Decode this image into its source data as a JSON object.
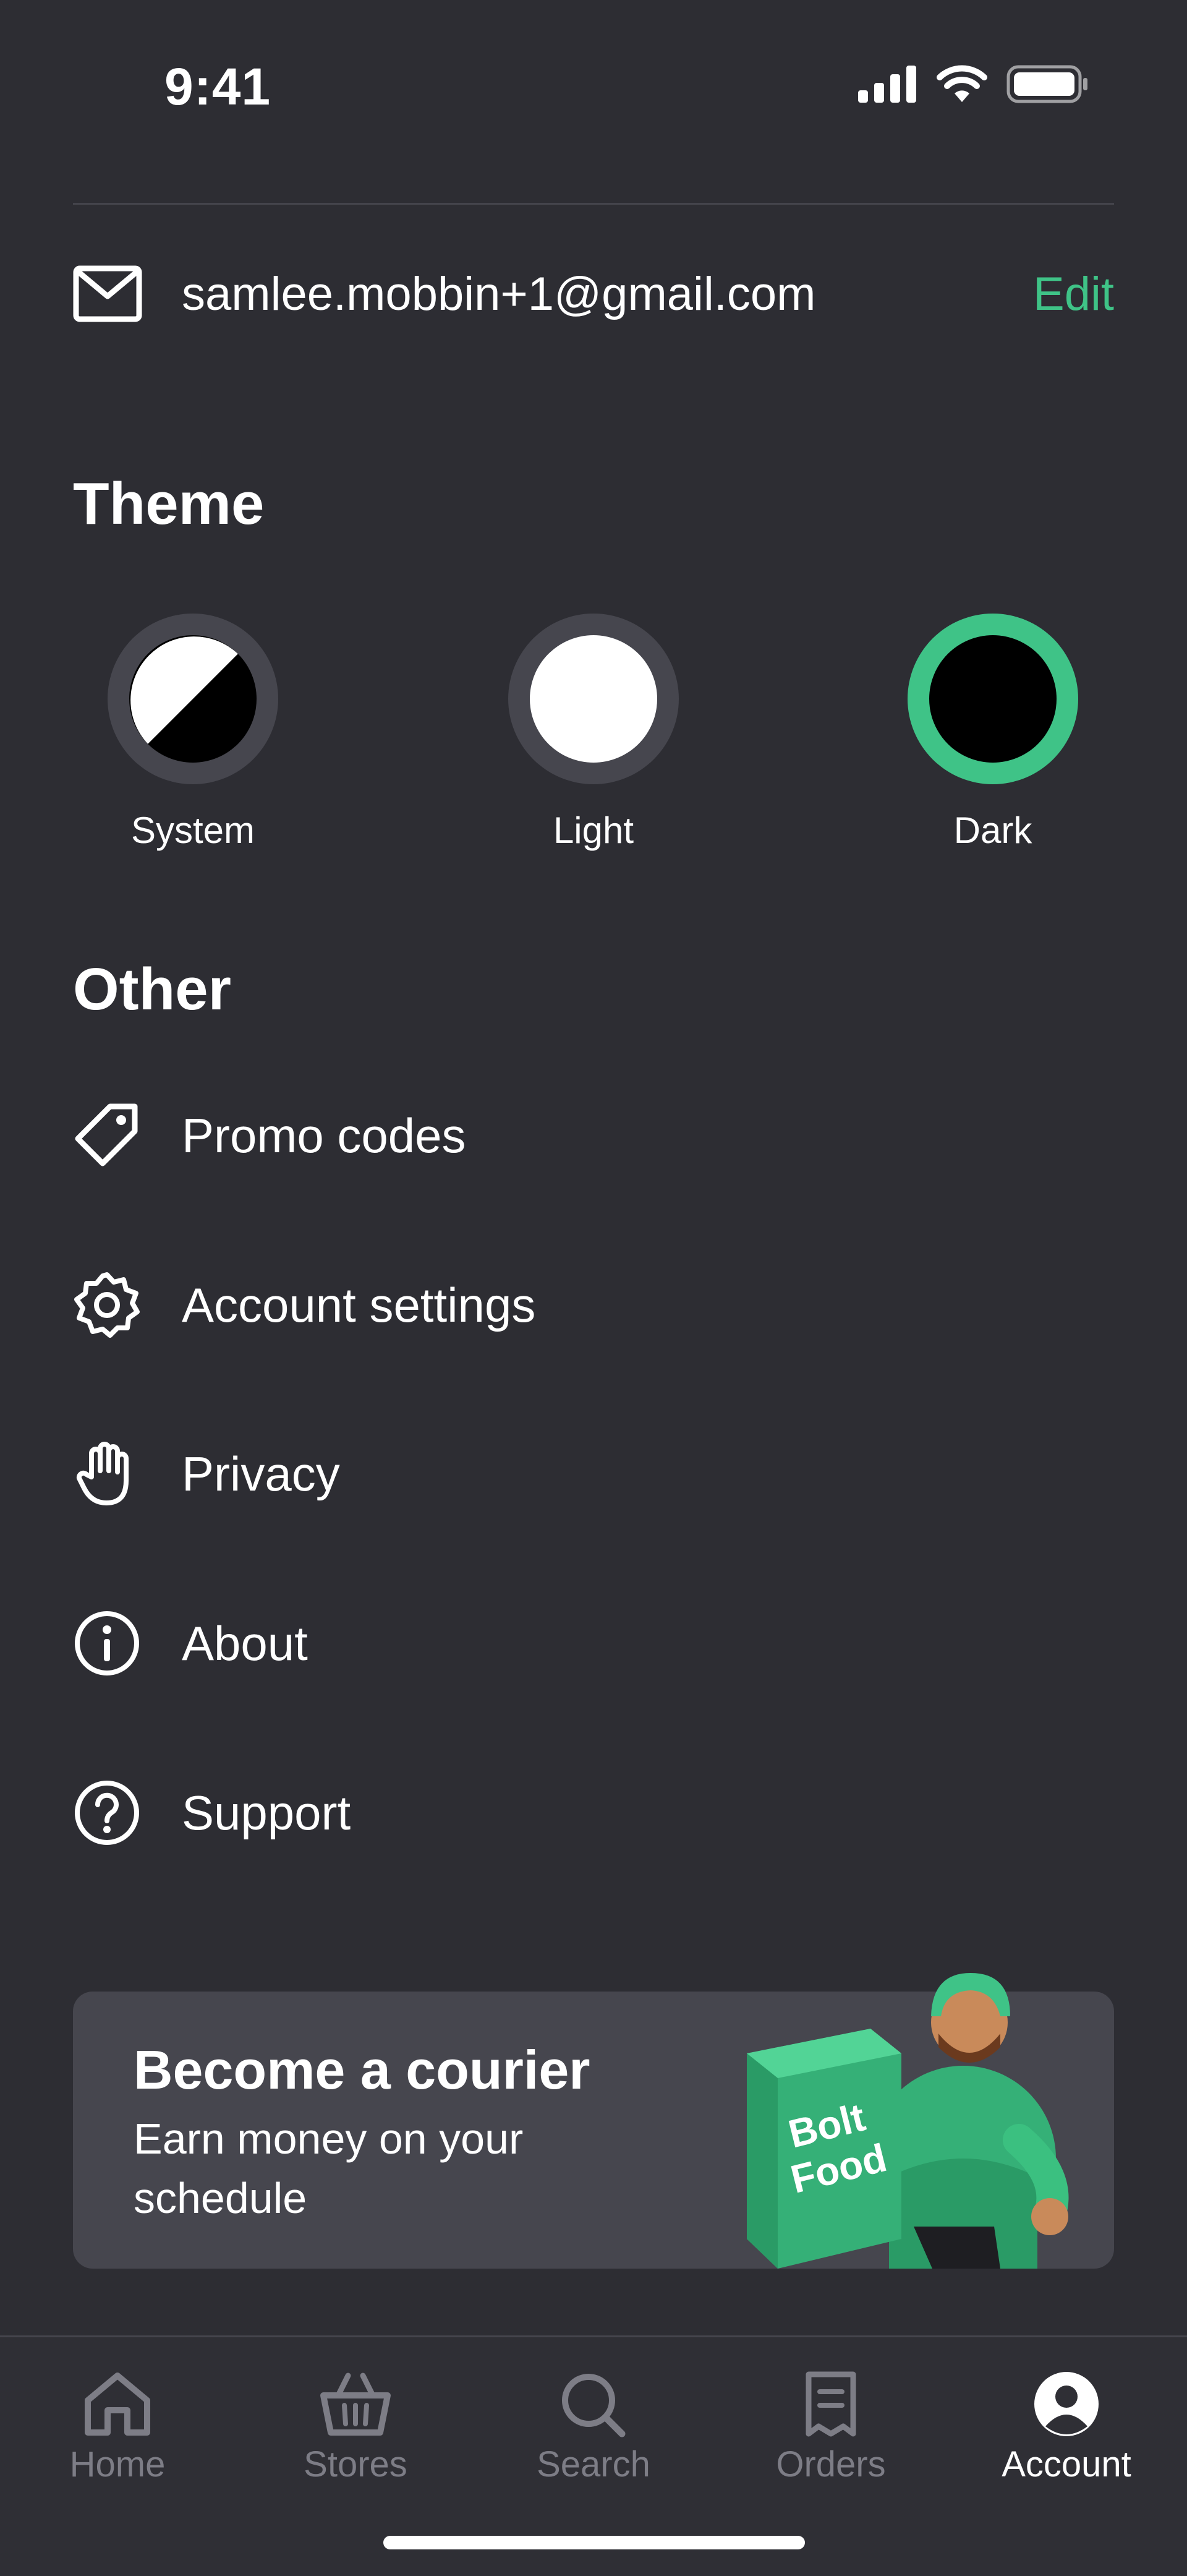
{
  "status_bar": {
    "time": "9:41"
  },
  "account": {
    "email": "samlee.mobbin+1@gmail.com",
    "edit_label": "Edit"
  },
  "theme": {
    "title": "Theme",
    "options": [
      {
        "label": "System",
        "selected": false
      },
      {
        "label": "Light",
        "selected": false
      },
      {
        "label": "Dark",
        "selected": true
      }
    ]
  },
  "other": {
    "title": "Other",
    "items": [
      {
        "label": "Promo codes",
        "icon": "tag-icon"
      },
      {
        "label": "Account settings",
        "icon": "gear-icon"
      },
      {
        "label": "Privacy",
        "icon": "hand-icon"
      },
      {
        "label": "About",
        "icon": "info-icon"
      },
      {
        "label": "Support",
        "icon": "help-icon"
      }
    ]
  },
  "banner": {
    "title": "Become a courier",
    "subtitle": "Earn money on your schedule",
    "box_text": "Bolt Food"
  },
  "tabs": [
    {
      "label": "Home",
      "icon": "home-icon",
      "active": false
    },
    {
      "label": "Stores",
      "icon": "basket-icon",
      "active": false
    },
    {
      "label": "Search",
      "icon": "search-icon",
      "active": false
    },
    {
      "label": "Orders",
      "icon": "receipt-icon",
      "active": false
    },
    {
      "label": "Account",
      "icon": "account-icon",
      "active": true
    }
  ],
  "colors": {
    "background": "#2d2d33",
    "accent": "#3fc387",
    "card": "#46464e",
    "muted": "#7d7d86"
  }
}
